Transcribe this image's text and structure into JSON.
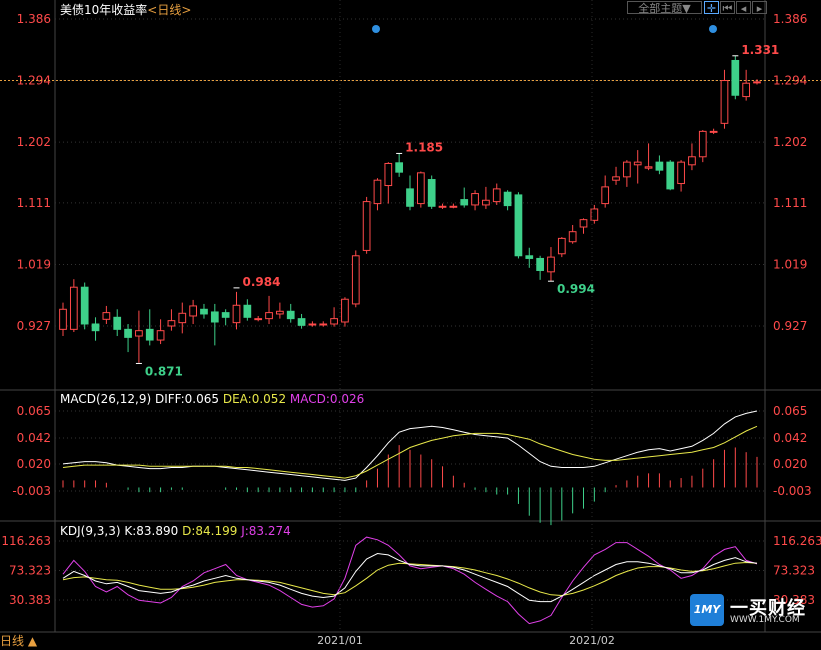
{
  "header": {
    "title": "美债10年收益率",
    "period_label": "<日线>",
    "theme_button": "全部主题▼",
    "toolbar_icons": [
      "crosshair-icon",
      "bar-back-icon",
      "bar-prev-icon",
      "bar-next-icon"
    ]
  },
  "colors": {
    "up": "#ff4a4a",
    "down": "#3ed08a",
    "price_label": "#ff4a4a",
    "diff": "#ffffff",
    "dea": "#e8e84a",
    "macd": "#e040e8",
    "kdj_k": "#ffffff",
    "kdj_d": "#e8e84a",
    "kdj_j": "#e040e8",
    "axis": "#ff4a4a",
    "grid": "#333333"
  },
  "chart_data": [
    {
      "type": "candlestick",
      "title": "美债10年收益率",
      "ylim": [
        0.86,
        1.4
      ],
      "yticks": [
        1.386,
        1.294,
        1.202,
        1.111,
        1.019,
        0.927
      ],
      "current_price_line": 1.294,
      "xticks": [
        "2021/01",
        "2021/02"
      ],
      "annotations": [
        {
          "text": "0.984",
          "value": 0.984,
          "kind": "high"
        },
        {
          "text": "0.871",
          "value": 0.871,
          "kind": "low"
        },
        {
          "text": "1.185",
          "value": 1.185,
          "kind": "high"
        },
        {
          "text": "0.994",
          "value": 0.994,
          "kind": "low"
        },
        {
          "text": "1.331",
          "value": 1.331,
          "kind": "high"
        }
      ],
      "candles": [
        {
          "o": 0.922,
          "c": 0.952,
          "h": 0.962,
          "l": 0.912
        },
        {
          "o": 0.922,
          "c": 0.985,
          "h": 0.997,
          "l": 0.918
        },
        {
          "o": 0.985,
          "c": 0.93,
          "h": 0.992,
          "l": 0.922
        },
        {
          "o": 0.93,
          "c": 0.92,
          "h": 0.94,
          "l": 0.905
        },
        {
          "o": 0.937,
          "c": 0.947,
          "h": 0.957,
          "l": 0.93
        },
        {
          "o": 0.94,
          "c": 0.922,
          "h": 0.952,
          "l": 0.912
        },
        {
          "o": 0.922,
          "c": 0.91,
          "h": 0.93,
          "l": 0.888
        },
        {
          "o": 0.912,
          "c": 0.92,
          "h": 0.95,
          "l": 0.872
        },
        {
          "o": 0.922,
          "c": 0.906,
          "h": 0.952,
          "l": 0.898
        },
        {
          "o": 0.906,
          "c": 0.92,
          "h": 0.937,
          "l": 0.9
        },
        {
          "o": 0.927,
          "c": 0.935,
          "h": 0.952,
          "l": 0.92
        },
        {
          "o": 0.932,
          "c": 0.946,
          "h": 0.962,
          "l": 0.916
        },
        {
          "o": 0.942,
          "c": 0.957,
          "h": 0.966,
          "l": 0.93
        },
        {
          "o": 0.952,
          "c": 0.945,
          "h": 0.96,
          "l": 0.938
        },
        {
          "o": 0.948,
          "c": 0.933,
          "h": 0.96,
          "l": 0.898
        },
        {
          "o": 0.947,
          "c": 0.94,
          "h": 0.952,
          "l": 0.928
        },
        {
          "o": 0.932,
          "c": 0.958,
          "h": 0.978,
          "l": 0.922
        },
        {
          "o": 0.958,
          "c": 0.94,
          "h": 0.967,
          "l": 0.935
        },
        {
          "o": 0.938,
          "c": 0.938,
          "h": 0.942,
          "l": 0.934
        },
        {
          "o": 0.938,
          "c": 0.947,
          "h": 0.972,
          "l": 0.93
        },
        {
          "o": 0.945,
          "c": 0.949,
          "h": 0.962,
          "l": 0.938
        },
        {
          "o": 0.949,
          "c": 0.938,
          "h": 0.96,
          "l": 0.932
        },
        {
          "o": 0.938,
          "c": 0.928,
          "h": 0.945,
          "l": 0.923
        },
        {
          "o": 0.93,
          "c": 0.93,
          "h": 0.934,
          "l": 0.926
        },
        {
          "o": 0.93,
          "c": 0.93,
          "h": 0.934,
          "l": 0.926
        },
        {
          "o": 0.93,
          "c": 0.938,
          "h": 0.955,
          "l": 0.926
        },
        {
          "o": 0.933,
          "c": 0.967,
          "h": 0.97,
          "l": 0.926
        },
        {
          "o": 0.96,
          "c": 1.032,
          "h": 1.04,
          "l": 0.955
        },
        {
          "o": 1.04,
          "c": 1.113,
          "h": 1.12,
          "l": 1.035
        },
        {
          "o": 1.11,
          "c": 1.145,
          "h": 1.148,
          "l": 1.1
        },
        {
          "o": 1.137,
          "c": 1.17,
          "h": 1.172,
          "l": 1.11
        },
        {
          "o": 1.171,
          "c": 1.157,
          "h": 1.185,
          "l": 1.15
        },
        {
          "o": 1.132,
          "c": 1.106,
          "h": 1.152,
          "l": 1.1
        },
        {
          "o": 1.11,
          "c": 1.156,
          "h": 1.158,
          "l": 1.104
        },
        {
          "o": 1.146,
          "c": 1.106,
          "h": 1.152,
          "l": 1.102
        },
        {
          "o": 1.106,
          "c": 1.106,
          "h": 1.11,
          "l": 1.102
        },
        {
          "o": 1.106,
          "c": 1.106,
          "h": 1.11,
          "l": 1.103
        },
        {
          "o": 1.116,
          "c": 1.108,
          "h": 1.134,
          "l": 1.104
        },
        {
          "o": 1.108,
          "c": 1.125,
          "h": 1.13,
          "l": 1.1
        },
        {
          "o": 1.108,
          "c": 1.115,
          "h": 1.135,
          "l": 1.102
        },
        {
          "o": 1.113,
          "c": 1.132,
          "h": 1.14,
          "l": 1.108
        },
        {
          "o": 1.127,
          "c": 1.107,
          "h": 1.13,
          "l": 1.1
        },
        {
          "o": 1.123,
          "c": 1.032,
          "h": 1.127,
          "l": 1.028
        },
        {
          "o": 1.032,
          "c": 1.028,
          "h": 1.044,
          "l": 1.014
        },
        {
          "o": 1.028,
          "c": 1.01,
          "h": 1.032,
          "l": 0.996
        },
        {
          "o": 1.008,
          "c": 1.03,
          "h": 1.045,
          "l": 0.994
        },
        {
          "o": 1.035,
          "c": 1.058,
          "h": 1.06,
          "l": 1.03
        },
        {
          "o": 1.053,
          "c": 1.068,
          "h": 1.078,
          "l": 1.05
        },
        {
          "o": 1.075,
          "c": 1.086,
          "h": 1.088,
          "l": 1.065
        },
        {
          "o": 1.085,
          "c": 1.102,
          "h": 1.108,
          "l": 1.08
        },
        {
          "o": 1.11,
          "c": 1.135,
          "h": 1.152,
          "l": 1.104
        },
        {
          "o": 1.145,
          "c": 1.15,
          "h": 1.165,
          "l": 1.138
        },
        {
          "o": 1.15,
          "c": 1.172,
          "h": 1.175,
          "l": 1.135
        },
        {
          "o": 1.168,
          "c": 1.172,
          "h": 1.19,
          "l": 1.14
        },
        {
          "o": 1.163,
          "c": 1.165,
          "h": 1.2,
          "l": 1.16
        },
        {
          "o": 1.172,
          "c": 1.16,
          "h": 1.182,
          "l": 1.154
        },
        {
          "o": 1.172,
          "c": 1.132,
          "h": 1.175,
          "l": 1.13
        },
        {
          "o": 1.14,
          "c": 1.172,
          "h": 1.175,
          "l": 1.128
        },
        {
          "o": 1.168,
          "c": 1.18,
          "h": 1.2,
          "l": 1.16
        },
        {
          "o": 1.18,
          "c": 1.218,
          "h": 1.22,
          "l": 1.172
        },
        {
          "o": 1.218,
          "c": 1.218,
          "h": 1.222,
          "l": 1.214
        },
        {
          "o": 1.23,
          "c": 1.294,
          "h": 1.31,
          "l": 1.222
        },
        {
          "o": 1.324,
          "c": 1.272,
          "h": 1.331,
          "l": 1.266
        },
        {
          "o": 1.27,
          "c": 1.29,
          "h": 1.31,
          "l": 1.264
        },
        {
          "o": 1.292,
          "c": 1.292,
          "h": 1.296,
          "l": 1.288
        }
      ]
    },
    {
      "type": "line",
      "title": "MACD(26,12,9)",
      "legend": [
        "DIFF:0.065",
        "DEA:0.052",
        "MACD:0.026"
      ],
      "yticks": [
        0.065,
        0.042,
        0.02,
        -0.003
      ],
      "ylim": [
        -0.03,
        0.072
      ],
      "diff": [
        0.02,
        0.021,
        0.022,
        0.022,
        0.021,
        0.019,
        0.018,
        0.017,
        0.016,
        0.016,
        0.017,
        0.017,
        0.018,
        0.018,
        0.018,
        0.017,
        0.016,
        0.015,
        0.014,
        0.013,
        0.012,
        0.011,
        0.01,
        0.009,
        0.008,
        0.007,
        0.006,
        0.008,
        0.017,
        0.027,
        0.038,
        0.047,
        0.05,
        0.051,
        0.052,
        0.051,
        0.049,
        0.047,
        0.045,
        0.044,
        0.043,
        0.042,
        0.036,
        0.029,
        0.022,
        0.018,
        0.017,
        0.017,
        0.017,
        0.018,
        0.021,
        0.024,
        0.027,
        0.03,
        0.032,
        0.033,
        0.031,
        0.033,
        0.035,
        0.04,
        0.046,
        0.054,
        0.06,
        0.063,
        0.065
      ],
      "dea": [
        0.017,
        0.018,
        0.019,
        0.019,
        0.019,
        0.019,
        0.019,
        0.019,
        0.018,
        0.018,
        0.018,
        0.018,
        0.018,
        0.018,
        0.018,
        0.018,
        0.017,
        0.017,
        0.016,
        0.015,
        0.014,
        0.013,
        0.012,
        0.011,
        0.01,
        0.009,
        0.008,
        0.01,
        0.014,
        0.019,
        0.024,
        0.029,
        0.034,
        0.037,
        0.04,
        0.042,
        0.044,
        0.045,
        0.046,
        0.046,
        0.046,
        0.045,
        0.043,
        0.041,
        0.037,
        0.034,
        0.031,
        0.028,
        0.026,
        0.024,
        0.023,
        0.023,
        0.024,
        0.025,
        0.026,
        0.027,
        0.028,
        0.029,
        0.03,
        0.032,
        0.034,
        0.038,
        0.043,
        0.048,
        0.052
      ]
    },
    {
      "type": "line",
      "title": "KDJ(9,3,3)",
      "legend": [
        "K:83.890",
        "D:84.199",
        "J:83.274"
      ],
      "yticks": [
        116.263,
        73.323,
        30.383
      ],
      "ylim": [
        -5,
        125
      ],
      "k": [
        62,
        72,
        66,
        58,
        54,
        56,
        50,
        44,
        42,
        40,
        42,
        48,
        52,
        58,
        62,
        66,
        62,
        60,
        58,
        56,
        52,
        46,
        40,
        36,
        34,
        36,
        48,
        72,
        90,
        98,
        96,
        88,
        82,
        80,
        80,
        80,
        78,
        74,
        68,
        62,
        56,
        50,
        40,
        30,
        28,
        28,
        36,
        46,
        56,
        66,
        74,
        82,
        86,
        86,
        84,
        80,
        76,
        70,
        70,
        74,
        82,
        88,
        92,
        86,
        84
      ],
      "d": [
        60,
        63,
        64,
        62,
        60,
        59,
        56,
        52,
        49,
        46,
        46,
        47,
        49,
        52,
        56,
        58,
        60,
        60,
        59,
        58,
        56,
        52,
        48,
        44,
        40,
        38,
        41,
        51,
        62,
        74,
        81,
        84,
        83,
        82,
        81,
        80,
        79,
        77,
        74,
        70,
        66,
        61,
        55,
        48,
        42,
        38,
        37,
        40,
        45,
        51,
        58,
        66,
        72,
        77,
        79,
        79,
        77,
        74,
        72,
        73,
        76,
        80,
        84,
        85,
        84
      ],
      "j": [
        68,
        88,
        72,
        50,
        42,
        50,
        38,
        30,
        28,
        26,
        34,
        50,
        58,
        70,
        76,
        82,
        66,
        60,
        56,
        52,
        44,
        34,
        24,
        20,
        22,
        32,
        62,
        110,
        122,
        118,
        110,
        96,
        80,
        76,
        78,
        80,
        76,
        68,
        56,
        46,
        36,
        28,
        10,
        -4,
        0,
        8,
        34,
        58,
        78,
        96,
        104,
        114,
        114,
        104,
        94,
        82,
        74,
        62,
        66,
        76,
        94,
        104,
        108,
        88,
        83
      ]
    }
  ],
  "footer": {
    "period_button": "日线 ▲"
  },
  "watermark": {
    "logo_text": "一买财经",
    "logo_badge": "1MY",
    "url": "WWW.1MY.COM"
  }
}
